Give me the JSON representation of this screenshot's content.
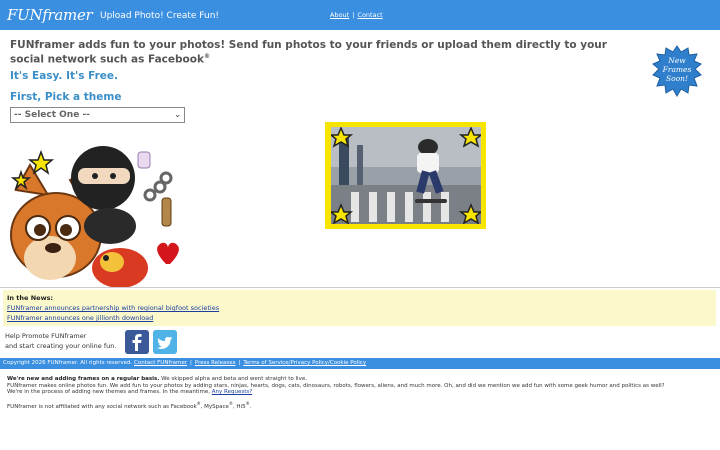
{
  "header": {
    "logo": "FUNframer",
    "tagline": "Upload Photo! Create Fun!",
    "links": [
      "About",
      "Contact"
    ],
    "separator": "|"
  },
  "main": {
    "headline": "FUNframer adds fun to your photos! Send fun photos to your friends or upload them directly to your social network such as Facebook",
    "headline_mark": "®",
    "easy": "It's Easy. It's Free.",
    "pick": "First, Pick a theme",
    "theme_select": {
      "value": "-- Select One --"
    },
    "badge": [
      "New",
      "Frames",
      "Soon!"
    ]
  },
  "news": {
    "title": "In the News:",
    "items": [
      "FUNframer announces partnership with regional bigfoot societies",
      "FUNframer announces one jillionth download"
    ]
  },
  "promote": {
    "line1": "Help Promote FUNframer",
    "line2": "and start creating your online fun."
  },
  "footer": {
    "copyright": "Copyright 2026 FUNframer. All rights reserved.",
    "links": [
      "Contact FUNframer",
      "Press Releases",
      "Terms of Service/Privacy Policy/Cookie Policy"
    ],
    "separator": "|"
  },
  "notes": {
    "bold": "We're new and adding frames on a regular basis.",
    "line1_rest": " We skipped alpha and beta and went straight to live.",
    "line2": "FUNframer makes online photos fun. We add fun to your photos by adding stars, ninjas, hearts, dogs, cats, dinosaurs, robots, flowers, aliens, and much more. Oh, and did we mention we add fun with some geek humor and politics as well?",
    "line3": "We're in the process of adding new themes and frames. In the meantime, ",
    "requests_link": "Any Requests?",
    "disclaimer_start": "FUNframer is not affiliated with any social network such as Facebook",
    "myspace": ", MySpace",
    "hi5": ", Hi5",
    "mark": "®",
    "period": "."
  },
  "colors": {
    "header_blue": "#3a8fe0",
    "heading_blue": "#3a8fc8",
    "frame_yellow": "#f7e500",
    "news_bg": "#fbf8cc"
  }
}
